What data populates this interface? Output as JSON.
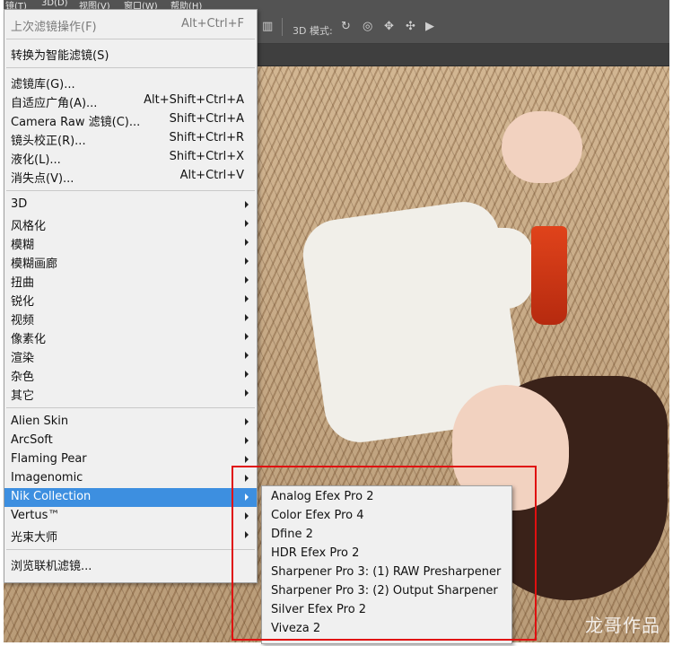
{
  "menubar": {
    "items": [
      "镜(T)",
      "3D(D)",
      "视图(V)",
      "窗口(W)",
      "帮助(H)"
    ]
  },
  "options_bar": {
    "mode_label": "3D 模式:"
  },
  "filter_menu": {
    "items": [
      {
        "label": "上次滤镜操作(F)",
        "shortcut": "Alt+Ctrl+F",
        "disabled": true
      },
      {
        "label": "转换为智能滤镜(S)"
      },
      {
        "label": "滤镜库(G)..."
      },
      {
        "label": "自适应广角(A)...",
        "shortcut": "Alt+Shift+Ctrl+A"
      },
      {
        "label": "Camera Raw 滤镜(C)...",
        "shortcut": "Shift+Ctrl+A"
      },
      {
        "label": "镜头校正(R)...",
        "shortcut": "Shift+Ctrl+R"
      },
      {
        "label": "液化(L)...",
        "shortcut": "Shift+Ctrl+X"
      },
      {
        "label": "消失点(V)...",
        "shortcut": "Alt+Ctrl+V"
      },
      {
        "label": "3D",
        "submenu": true
      },
      {
        "label": "风格化",
        "submenu": true
      },
      {
        "label": "模糊",
        "submenu": true
      },
      {
        "label": "模糊画廊",
        "submenu": true
      },
      {
        "label": "扭曲",
        "submenu": true
      },
      {
        "label": "锐化",
        "submenu": true
      },
      {
        "label": "视频",
        "submenu": true
      },
      {
        "label": "像素化",
        "submenu": true
      },
      {
        "label": "渲染",
        "submenu": true
      },
      {
        "label": "杂色",
        "submenu": true
      },
      {
        "label": "其它",
        "submenu": true
      },
      {
        "label": "Alien Skin",
        "submenu": true
      },
      {
        "label": "ArcSoft",
        "submenu": true
      },
      {
        "label": "Flaming Pear",
        "submenu": true
      },
      {
        "label": "Imagenomic",
        "submenu": true
      },
      {
        "label": "Nik Collection",
        "submenu": true,
        "highlighted": true
      },
      {
        "label": "Vertus™",
        "submenu": true
      },
      {
        "label": "光束大师",
        "submenu": true
      },
      {
        "label": "浏览联机滤镜..."
      }
    ]
  },
  "nik_submenu": {
    "items": [
      "Analog Efex Pro 2",
      "Color Efex Pro 4",
      "Dfine 2",
      "HDR Efex Pro 2",
      "Sharpener Pro 3: (1) RAW Presharpener",
      "Sharpener Pro 3: (2) Output Sharpener",
      "Silver Efex Pro 2",
      "Viveza 2"
    ]
  },
  "watermark": "龙哥作品",
  "colors": {
    "highlight": "#3d8fe0",
    "annotation_box": "#e01010",
    "tassel": "#d8381a"
  },
  "icons": [
    "3d-rotate-icon",
    "3d-roll-icon",
    "3d-pan-icon",
    "3d-slide-icon",
    "3d-camera-icon",
    "panel-icon"
  ]
}
